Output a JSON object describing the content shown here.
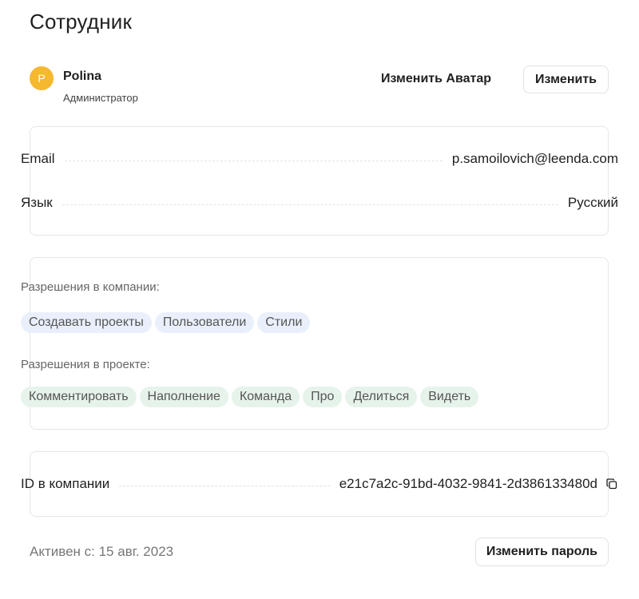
{
  "page": {
    "title": "Сотрудник"
  },
  "user": {
    "avatar_letter": "P",
    "avatar_color": "#f5b82e",
    "name": "Polina",
    "role": "Администратор",
    "change_avatar_label": "Изменить Аватар",
    "edit_label": "Изменить"
  },
  "info": {
    "email_label": "Email",
    "email_value": "p.samoilovich@leenda.com",
    "language_label": "Язык",
    "language_value": "Русский"
  },
  "permissions": {
    "company_title": "Разрешения в компании:",
    "company": [
      "Создавать проекты",
      "Пользователи",
      "Стили"
    ],
    "project_title": "Разрешения в проекте:",
    "project": [
      "Комментировать",
      "Наполнение",
      "Команда",
      "Про",
      "Делиться",
      "Видеть"
    ],
    "company_chip_color": "#e9f0fb",
    "project_chip_color": "#e6f3ea"
  },
  "company_id": {
    "label": "ID в компании",
    "value": "e21c7a2c-91bd-4032-9841-2d386133480d",
    "copy_icon": "copy-icon"
  },
  "footer": {
    "active_since": "Активен с: 15 авг. 2023",
    "change_password_label": "Изменить пароль"
  }
}
